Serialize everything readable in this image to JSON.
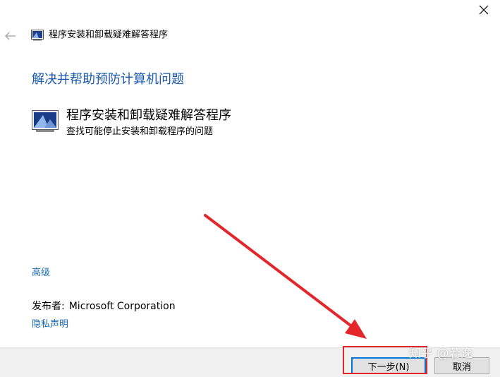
{
  "window": {
    "title": "程序安装和卸载疑难解答程序",
    "close_icon": "close-icon",
    "back_icon": "back-arrow-icon"
  },
  "main": {
    "heading": "解决并帮助预防计算机问题",
    "troubleshooter": {
      "title": "程序安装和卸载疑难解答程序",
      "description": "查找可能停止安装和卸载程序的问题",
      "icon": "troubleshooter-app-icon"
    },
    "advanced_link": "高级",
    "publisher_label": "发布者:",
    "publisher_value": "Microsoft Corporation",
    "privacy_link": "隐私声明"
  },
  "footer": {
    "next_label": "下一步(N)",
    "cancel_label": "取消"
  },
  "watermark": "知乎 @若逸",
  "colors": {
    "heading": "#1a5aa8",
    "link": "#1a6ab0",
    "annotation": "#e4262b",
    "footer_bg": "#f0f0f0",
    "primary_border": "#0078d7"
  }
}
